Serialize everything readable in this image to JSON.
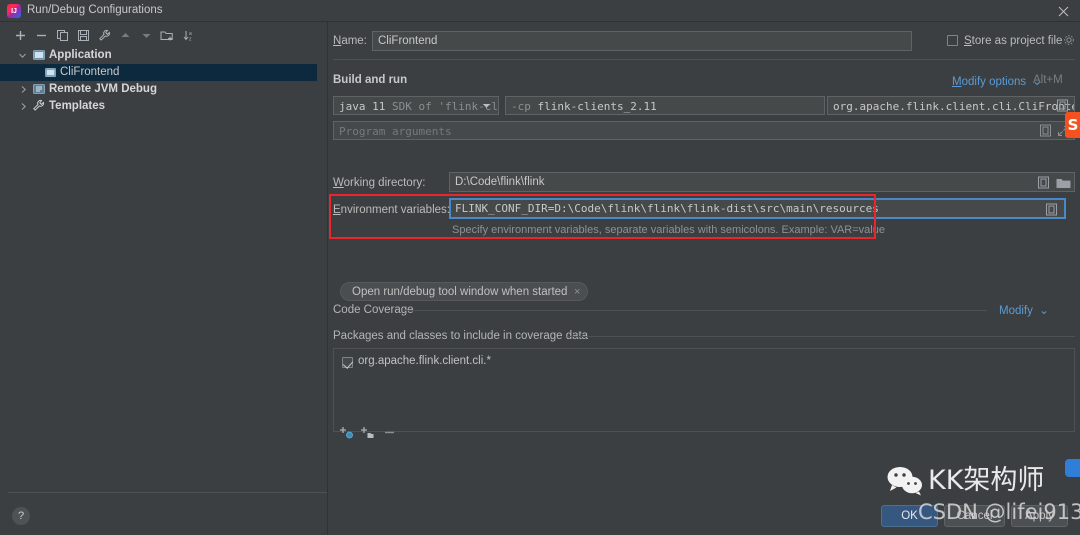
{
  "window": {
    "title": "Run/Debug Configurations",
    "logo_text": "IJ",
    "close_icon": "close-icon"
  },
  "sidebar": {
    "toolbar": [
      {
        "name": "add-configuration-icon",
        "glyph": "+"
      },
      {
        "name": "remove-configuration-icon",
        "glyph": "−"
      },
      {
        "name": "copy-configuration-icon",
        "glyph": "copy"
      },
      {
        "name": "save-configuration-icon",
        "glyph": "save"
      },
      {
        "name": "edit-templates-icon",
        "glyph": "wrench"
      },
      {
        "name": "move-up-icon",
        "glyph": "up"
      },
      {
        "name": "move-down-icon",
        "glyph": "down"
      },
      {
        "name": "move-into-folder-icon",
        "glyph": "folder-add"
      },
      {
        "name": "sort-configurations-icon",
        "glyph": "sort-az"
      }
    ],
    "tree": [
      {
        "label": "Application",
        "level": 0,
        "expanded": true,
        "bold": true,
        "icon": "application-icon",
        "selected": false
      },
      {
        "label": "CliFrontend",
        "level": 1,
        "expanded": null,
        "bold": false,
        "icon": "application-icon",
        "selected": true
      },
      {
        "label": "Remote JVM Debug",
        "level": 0,
        "expanded": false,
        "bold": true,
        "icon": "remote-debug-icon",
        "selected": false
      },
      {
        "label": "Templates",
        "level": 0,
        "expanded": false,
        "bold": true,
        "icon": "templates-icon",
        "selected": false
      }
    ],
    "help_label": "?"
  },
  "form": {
    "name_label": "Name:",
    "name_label_mnemonic": "N",
    "name_value": "CliFrontend",
    "store_as_project_file_label": "Store as project file",
    "store_as_project_file_mnemonic": "S",
    "store_as_project_file_checked": false,
    "store_gear_icon": "gear-icon",
    "build_and_run_title": "Build and run",
    "modify_options_label": "Modify options",
    "modify_options_mnemonic": "M",
    "modify_options_shortcut": "Alt+M",
    "jre_value": "java 11 SDK of 'flink-cl",
    "jre_prefix": "java 11",
    "jre_suffix": "SDK of 'flink-cl",
    "cp_value": "-cp flink-clients_2.11",
    "cp_prefix": "-cp",
    "cp_suffix": "flink-clients_2.11",
    "main_class_value": "org.apache.flink.client.cli.CliFrontend",
    "program_arguments_placeholder": "Program arguments",
    "working_directory_label": "Working directory:",
    "working_directory_mnemonic": "W",
    "working_directory_value": "D:\\Code\\flink\\flink",
    "environment_variables_label": "Environment variables:",
    "environment_variables_mnemonic": "E",
    "environment_variables_value": "FLINK_CONF_DIR=D:\\Code\\flink\\flink\\flink-dist\\src\\main\\resources",
    "environment_variables_hint": "Specify environment variables, separate variables with semicolons. Example: VAR=value",
    "option_chip_label": "Open run/debug tool window when started",
    "option_chip_close_icon": "close-icon",
    "expand_icon": "expand-editor-icon",
    "browse_folder_icon": "browse-folder-icon",
    "expand_arrows_icon": "expand-arrows-icon"
  },
  "coverage": {
    "section_title": "Code Coverage",
    "modify_label": "Modify",
    "modify_chevron_icon": "chevron-down-icon",
    "list_title": "Packages and classes to include in coverage data",
    "items": [
      {
        "label": "org.apache.flink.client.cli.*",
        "checked": true
      }
    ],
    "toolbar": [
      {
        "name": "add-class-pattern-icon",
        "glyph": "add-class"
      },
      {
        "name": "add-package-pattern-icon",
        "glyph": "add-package"
      },
      {
        "name": "remove-pattern-icon",
        "glyph": "remove"
      }
    ]
  },
  "footer": {
    "ok_label": "OK",
    "cancel_label": "Cancel",
    "apply_label": "Apply"
  },
  "annotation": {
    "highlight_color": "#e8262b"
  },
  "watermark": {
    "wechat_icon": "wechat-icon",
    "account_name": "KK架构师",
    "csdn_text": "CSDN @lifei913",
    "ime_badge": "S"
  }
}
